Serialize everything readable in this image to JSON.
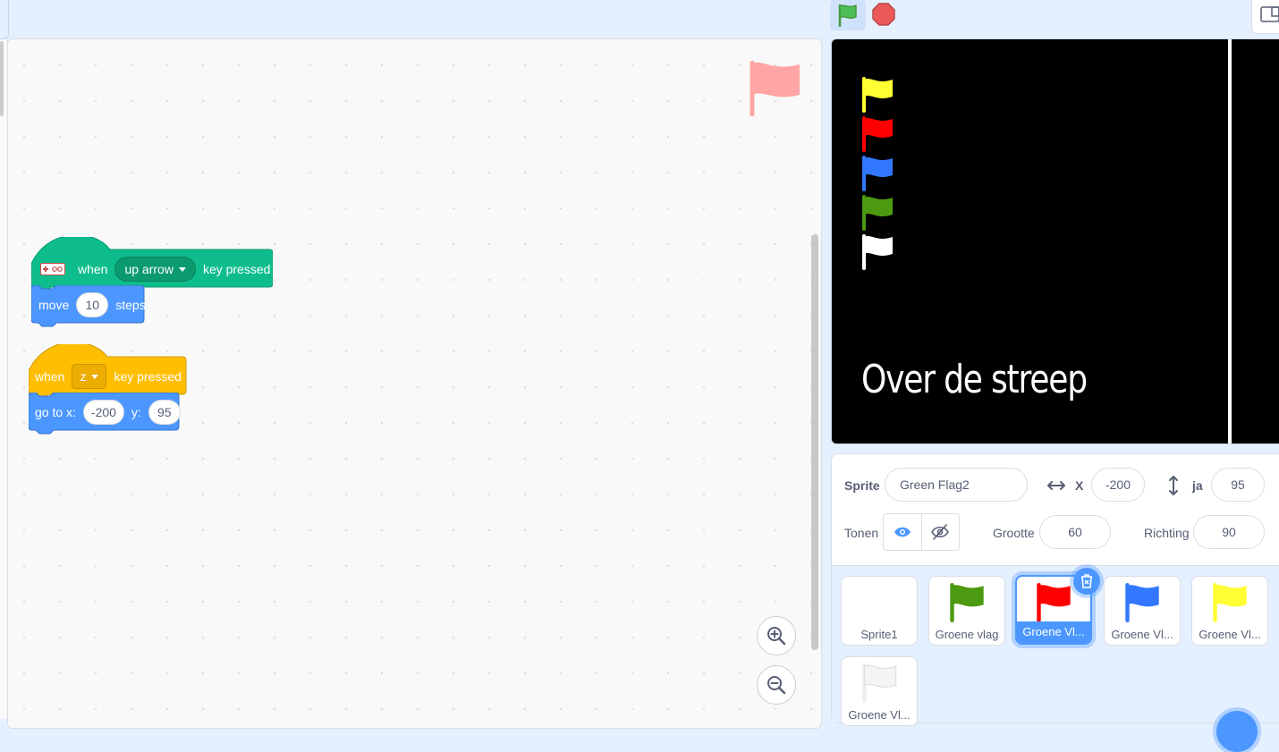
{
  "colors": {
    "events": "#ffbf00",
    "extension": "#0fbd8c",
    "motion": "#4c97ff",
    "accent": "#4c97ff",
    "flag_yellow": "#ffff33",
    "flag_red": "#ff0000",
    "flag_blue": "#3377ff",
    "flag_green": "#4c9a0f",
    "flag_white": "#ffffff",
    "workspace_flag": "#ffa5a5"
  },
  "toolbar": {
    "green_flag_icon": "green-flag-icon",
    "stop_icon": "stop-sign-icon",
    "layout_icon": "small-stage-icon"
  },
  "scripts": [
    {
      "hat": {
        "icon": "makey-makey-icon",
        "when": "when",
        "key": "up arrow",
        "suffix": "key pressed"
      },
      "command": {
        "label": "move",
        "value": "10",
        "suffix": "steps"
      }
    },
    {
      "hat": {
        "when": "when",
        "key": "z",
        "suffix": "key pressed"
      },
      "command": {
        "label": "go to x:",
        "x": "-200",
        "y_label": "y:",
        "y": "95"
      }
    }
  ],
  "zoom": {
    "in_icon": "zoom-in-icon",
    "out_icon": "zoom-out-icon"
  },
  "stage": {
    "text": "Over de streep",
    "flags": [
      "yellow",
      "red",
      "blue",
      "green",
      "white"
    ]
  },
  "sprite_info": {
    "sprite_label": "Sprite",
    "sprite_name": "Green Flag2",
    "x_label": "X",
    "x_value": "-200",
    "y_label": "ja",
    "y_value": "95",
    "show_label": "Tonen",
    "size_label": "Grootte",
    "size_value": "60",
    "direction_label": "Richting",
    "direction_value": "90"
  },
  "sprites": [
    {
      "name": "Sprite1",
      "flag": null,
      "selected": false
    },
    {
      "name": "Groene vlag",
      "flag": "green",
      "selected": false
    },
    {
      "name": "Groene Vl...",
      "flag": "red",
      "selected": true
    },
    {
      "name": "Groene Vl...",
      "flag": "blue",
      "selected": false
    },
    {
      "name": "Groene Vl...",
      "flag": "yellow",
      "selected": false
    },
    {
      "name": "Groene Vl...",
      "flag": "white",
      "selected": false
    }
  ]
}
